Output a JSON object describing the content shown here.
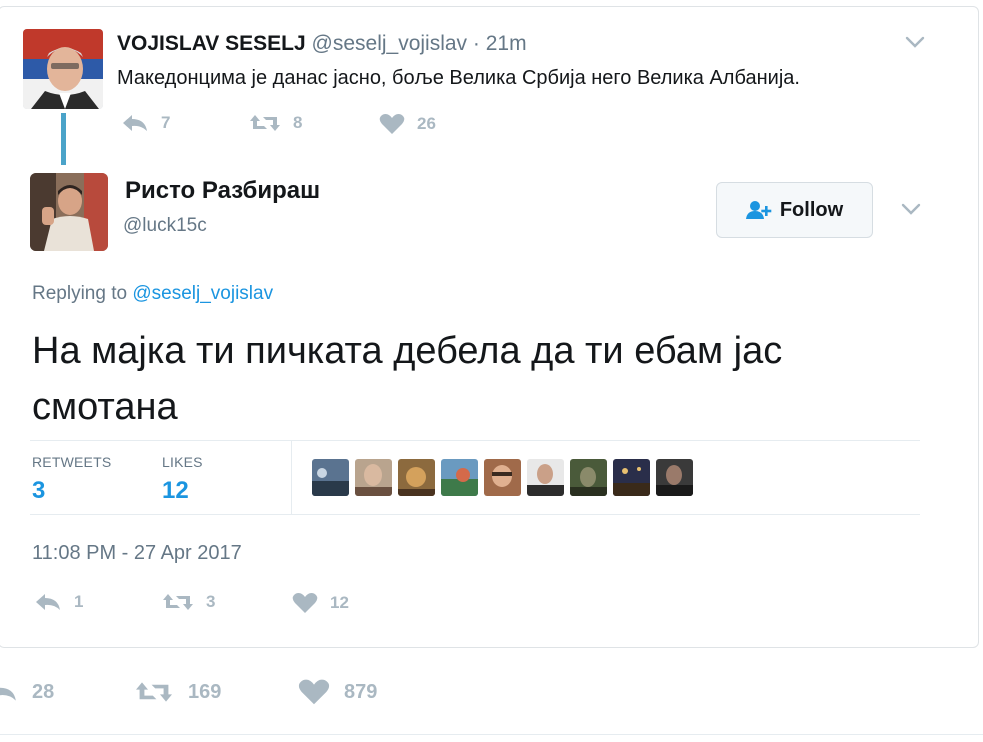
{
  "parent_tweet": {
    "name": "VOJISLAV SESELJ",
    "handle": "@seselj_vojislav",
    "separator": "·",
    "time": "21m",
    "text": "Македонцима је данас јасно, боље Велика Србија него Велика Албанија.",
    "actions": {
      "reply": "7",
      "retweet": "8",
      "like": "26"
    }
  },
  "reply_tweet": {
    "name": "Ристо Разбираш",
    "handle": "@luck15c",
    "follow_label": "Follow",
    "replying_prefix": "Replying to",
    "replying_to": "@seselj_vojislav",
    "text": "На мајка ти пичката дебела да ти ебам јас смотана",
    "stats": {
      "retweets_label": "RETWEETS",
      "retweets": "3",
      "likes_label": "LIKES",
      "likes": "12"
    },
    "timestamp": "11:08 PM - 27 Apr 2017",
    "actions": {
      "reply": "1",
      "retweet": "3",
      "like": "12"
    }
  },
  "outer_actions": {
    "reply": "28",
    "retweet": "169",
    "like": "879"
  },
  "icons": {
    "reply": "reply-icon",
    "retweet": "retweet-icon",
    "like": "heart-icon",
    "menu": "chevron-down-icon",
    "follow": "add-user-icon"
  },
  "colors": {
    "link": "#1b95e0",
    "muted": "#657786",
    "action_gray": "#aab8c2",
    "thread_line": "#4aa3c9"
  }
}
